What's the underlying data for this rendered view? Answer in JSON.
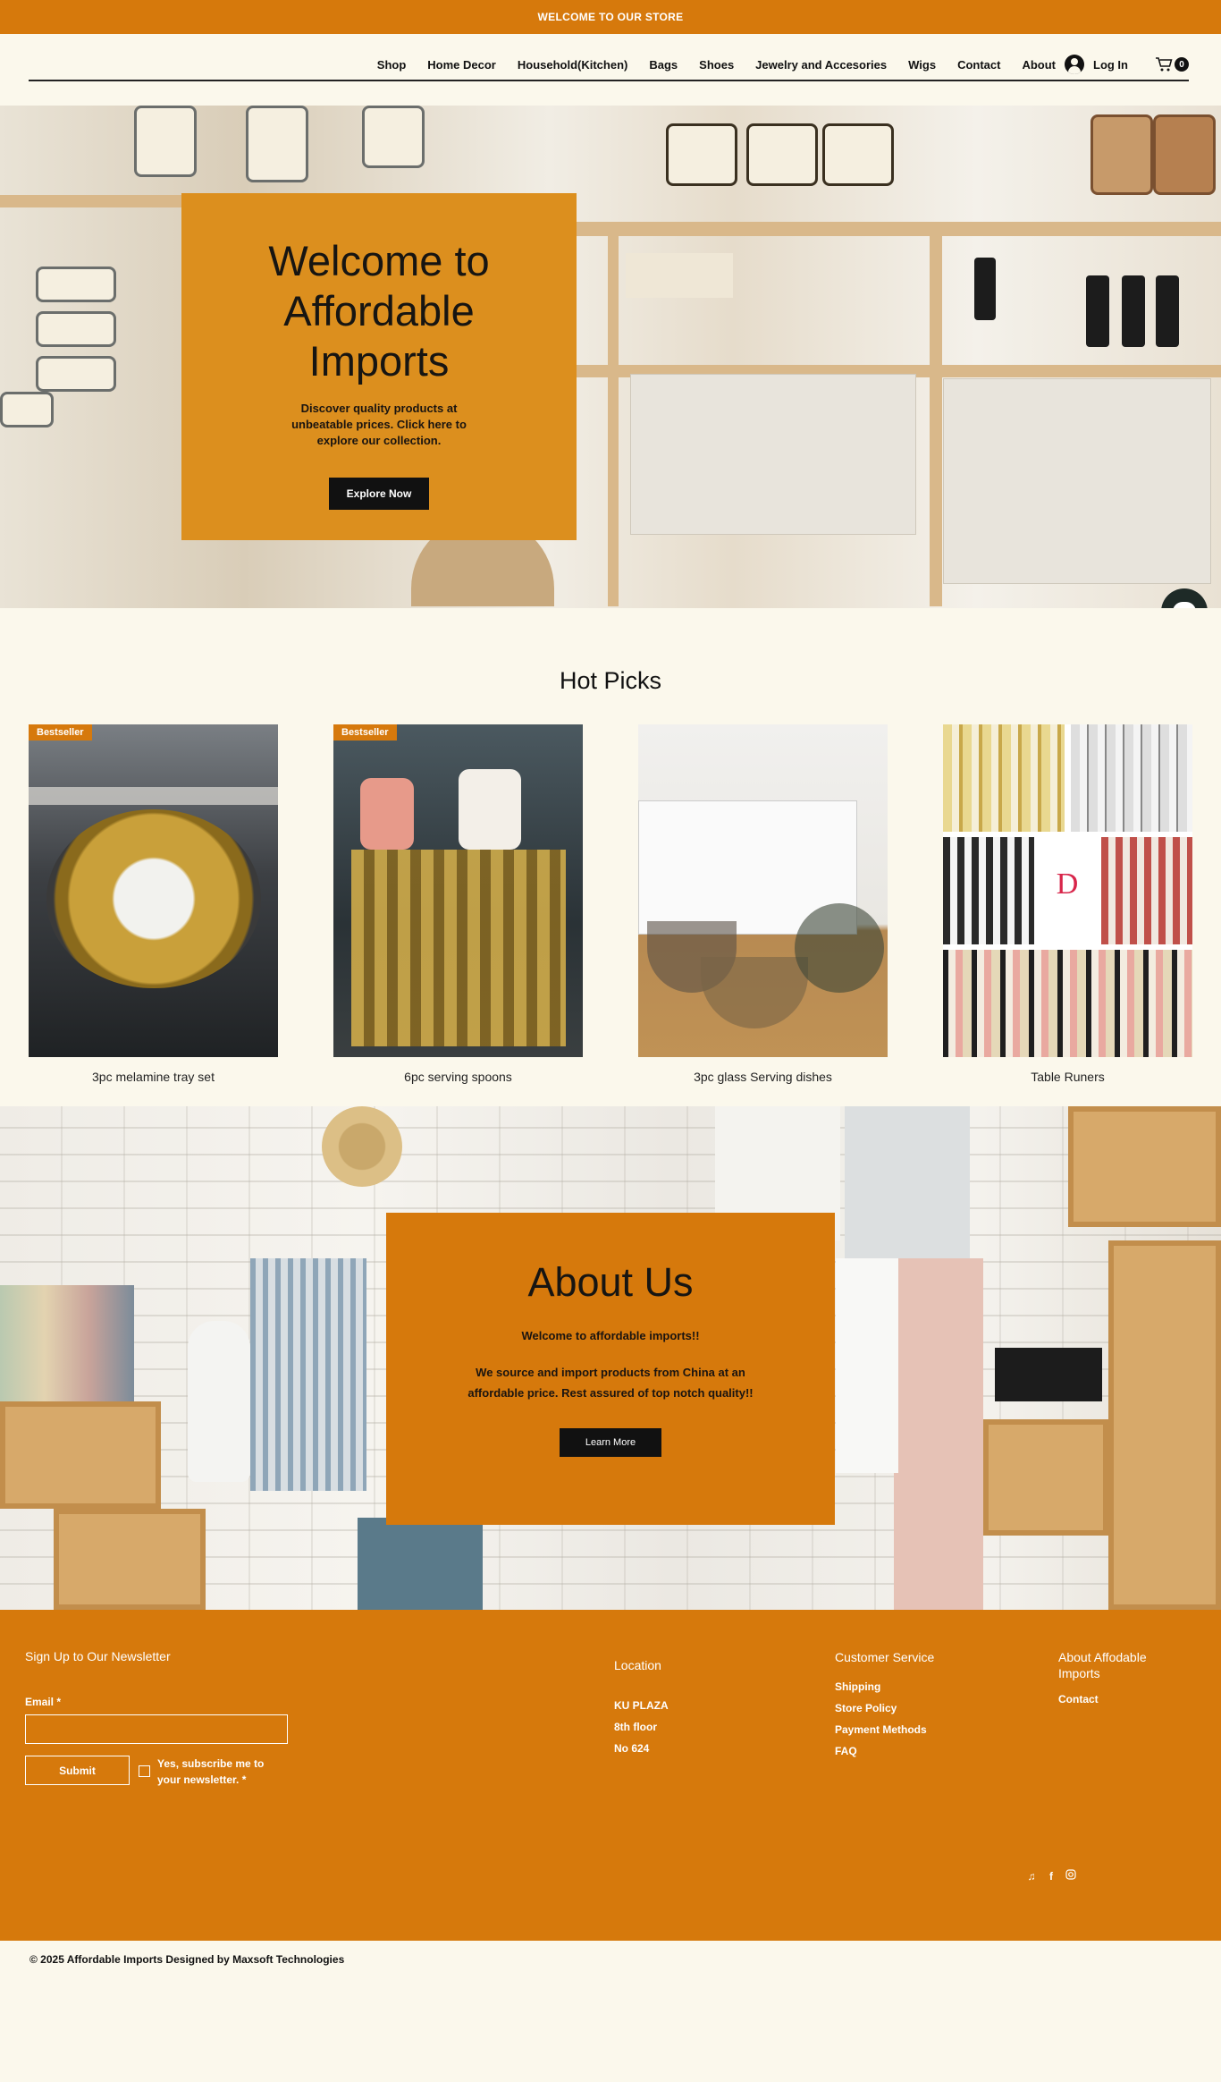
{
  "announcement": "WELCOME TO OUR STORE",
  "nav": {
    "items": [
      "Shop",
      "Home Decor",
      "Household(Kitchen)",
      "Bags",
      "Shoes",
      "Jewelry and Accesories",
      "Wigs",
      "Contact",
      "About"
    ],
    "login_label": "Log In",
    "cart_count": "0"
  },
  "hero": {
    "title": "Welcome to Affordable Imports",
    "subtitle": "Discover quality products at unbeatable prices. Click here to explore our collection.",
    "button": "Explore Now"
  },
  "hot_picks": {
    "title": "Hot Picks",
    "products": [
      {
        "name": "3pc melamine tray set",
        "badge": "Bestseller"
      },
      {
        "name": "6pc serving spoons",
        "badge": "Bestseller"
      },
      {
        "name": "3pc glass Serving dishes",
        "badge": ""
      },
      {
        "name": "Table Runers",
        "badge": ""
      }
    ]
  },
  "about": {
    "title": "About Us",
    "intro": "Welcome to affordable imports!!",
    "body": "We source and import products from China at an affordable price. Rest assured of top notch quality!!",
    "button": "Learn More"
  },
  "footer": {
    "newsletter": {
      "title": "Sign Up to Our Newsletter",
      "email_label": "Email *",
      "submit": "Submit",
      "checkbox_label": "Yes, subscribe me to your newsletter. *"
    },
    "location": {
      "title": "Location",
      "lines": [
        "KU PLAZA",
        "8th floor",
        "No 624"
      ]
    },
    "customer_service": {
      "title": "Customer Service",
      "links": [
        "Shipping",
        "Store Policy",
        "Payment Methods",
        "FAQ"
      ]
    },
    "about": {
      "title": "About Affodable Imports",
      "links": [
        "Contact"
      ]
    },
    "social_icons": [
      "tiktok-icon",
      "facebook-icon",
      "instagram-icon"
    ]
  },
  "copyright": "© 2025 Affordable Imports Designed by Maxsoft Technologies",
  "colors": {
    "accent": "#d6790c",
    "hero_box": "#dc8f1e",
    "background": "#fbf8ec"
  }
}
